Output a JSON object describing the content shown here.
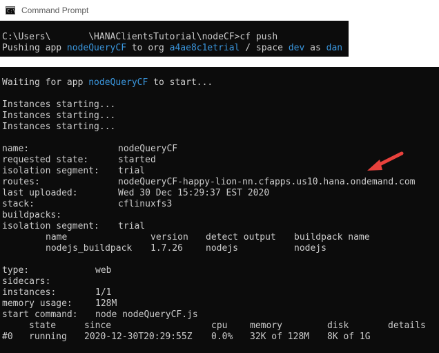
{
  "window": {
    "title": "Command Prompt",
    "icon": "cmd-icon",
    "icon_text": "C:\\"
  },
  "top_terminal": {
    "prompt": "C:\\Users\\       \\HANAClientsTutorial\\nodeCF>cf push",
    "pushing": {
      "p1": "Pushing app ",
      "app": "nodeQueryCF",
      "p2": " to org ",
      "org": "a4ae8c1etrial",
      "p3": " / space ",
      "space": "dev",
      "p4": " as ",
      "user": "dan"
    }
  },
  "bottom_terminal": {
    "waiting": {
      "p1": "Waiting for app ",
      "app": "nodeQueryCF",
      "p2": " to start..."
    },
    "instances_starting": [
      "Instances starting...",
      "Instances starting...",
      "Instances starting..."
    ],
    "app_info": [
      {
        "key": "name:",
        "value": "nodeQueryCF"
      },
      {
        "key": "requested state:",
        "value": "started"
      },
      {
        "key": "isolation segment:",
        "value": "trial"
      },
      {
        "key": "routes:",
        "value": "nodeQueryCF-happy-lion-nn.cfapps.us10.hana.ondemand.com"
      },
      {
        "key": "last uploaded:",
        "value": "Wed 30 Dec 15:29:37 EST 2020"
      },
      {
        "key": "stack:",
        "value": "cflinuxfs3"
      },
      {
        "key": "buildpacks:",
        "value": ""
      },
      {
        "key": "isolation segment:",
        "value": "trial"
      }
    ],
    "buildpack_table": {
      "headers": [
        "name",
        "version",
        "detect output",
        "buildpack name"
      ],
      "rows": [
        [
          "nodejs_buildpack",
          "1.7.26",
          "nodejs",
          "nodejs"
        ]
      ]
    },
    "process_info": [
      {
        "key": "type:",
        "value": "web"
      },
      {
        "key": "sidecars:",
        "value": ""
      },
      {
        "key": "instances:",
        "value": "1/1"
      },
      {
        "key": "memory usage:",
        "value": "128M"
      },
      {
        "key": "start command:",
        "value": "node nodeQueryCF.js"
      }
    ],
    "instance_table": {
      "headers": [
        "state",
        "since",
        "cpu",
        "memory",
        "disk",
        "details"
      ],
      "rows": [
        {
          "index": "#0",
          "cells": [
            "running",
            "2020-12-30T20:29:55Z",
            "0.0%",
            "32K of 128M",
            "8K of 1G",
            ""
          ]
        }
      ]
    }
  },
  "annotation": {
    "icon": "arrow-icon",
    "color": "#e8413c"
  },
  "colors": {
    "terminal_bg": "#0c0c0c",
    "terminal_text": "#cccccc",
    "highlight": "#3a96dd"
  }
}
